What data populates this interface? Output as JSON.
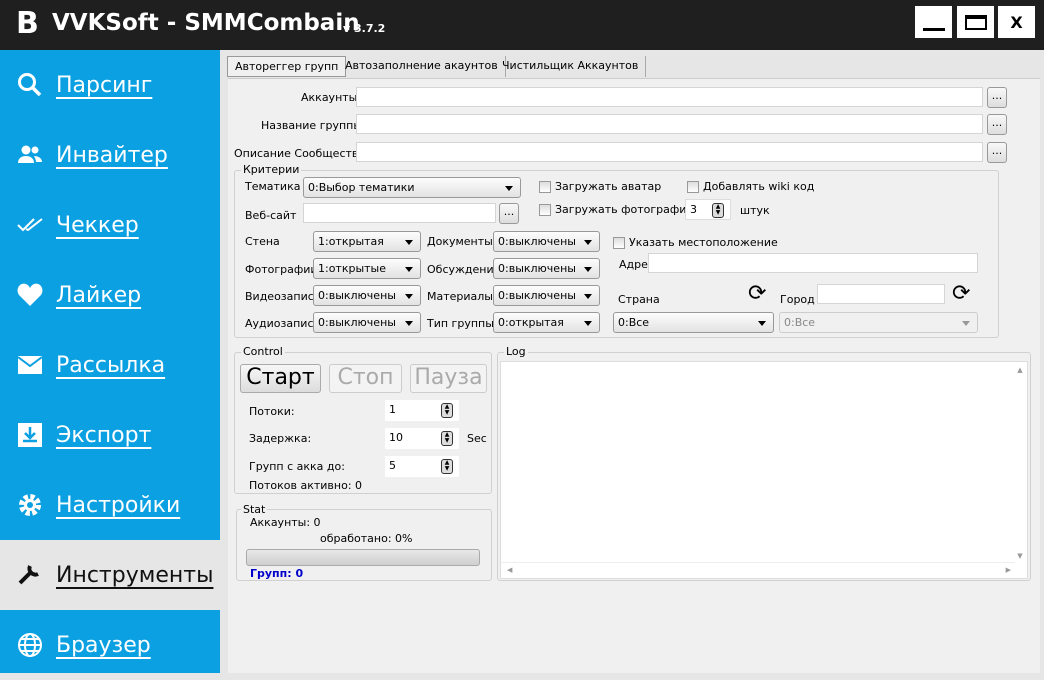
{
  "window": {
    "logo": "B",
    "title": "VVKSoft - SMMCombain",
    "version": "v 3.7.2",
    "min": "—",
    "max": "▭",
    "close": "X"
  },
  "sidebar": {
    "items": [
      {
        "label": "Парсинг",
        "icon": "search-icon"
      },
      {
        "label": "Инвайтер",
        "icon": "users-icon"
      },
      {
        "label": "Чеккер",
        "icon": "double-check-icon"
      },
      {
        "label": "Лайкер",
        "icon": "heart-icon"
      },
      {
        "label": "Рассылка",
        "icon": "mail-icon"
      },
      {
        "label": "Экспорт",
        "icon": "download-icon"
      },
      {
        "label": "Настройки",
        "icon": "gear-icon"
      },
      {
        "label": "Инструменты",
        "icon": "wrench-icon",
        "selected": true
      },
      {
        "label": "Браузер",
        "icon": "globe-icon"
      }
    ]
  },
  "tabs": [
    {
      "label": "Автореггер групп",
      "selected": true
    },
    {
      "label": "Автозаполнение акаунтов"
    },
    {
      "label": "Чистильщик Аккаунтов"
    }
  ],
  "form": {
    "accounts_label": "Аккаунты",
    "group_name_label": "Название группы",
    "description_label": "Описание Сообщества",
    "browse": "..."
  },
  "criteria": {
    "title": "Критерии",
    "theme_label": "Тематика",
    "theme_value": "0:Выбор тематики",
    "website_label": "Веб-сайт",
    "upload_avatar": "Загружать аватар",
    "add_wiki": "Добавлять wiki код",
    "upload_photos": "Загружать фотографии",
    "photos_count": "3",
    "photos_unit": "штук",
    "wall_label": "Стена",
    "wall_value": "1:открытая",
    "photos_label": "Фотографии",
    "photos_value": "1:открытые",
    "video_label": "Видеозаписи",
    "video_value": "0:выключены",
    "audio_label": "Аудиозаписи",
    "audio_value": "0:выключены",
    "docs_label": "Документы",
    "docs_value": "0:выключены",
    "discussions_label": "Обсуждения",
    "discussions_value": "0:выключены",
    "materials_label": "Материалы",
    "materials_value": "0:выключены",
    "group_type_label": "Тип группы",
    "group_type_value": "0:открытая",
    "location": "Указать местоположение",
    "address_label": "Адрес",
    "country_label": "Страна",
    "country_value": "0:Все",
    "city_label": "Город",
    "city_value": "0:Все"
  },
  "control": {
    "title": "Control",
    "start": "Старт",
    "stop": "Стоп",
    "pause": "Пауза",
    "threads_label": "Потоки:",
    "threads": "1",
    "delay_label": "Задержка:",
    "delay": "10",
    "delay_unit": "Sec",
    "groups_label": "Групп с акка до:",
    "groups": "5",
    "active_label": "Потоков активно: 0"
  },
  "stat": {
    "title": "Stat",
    "accounts": "Аккаунты: 0",
    "processed": "обработано: 0%",
    "progress": 0,
    "groups": "Групп: 0",
    "groups_color": "#0000cc"
  },
  "log": {
    "title": "Log"
  }
}
